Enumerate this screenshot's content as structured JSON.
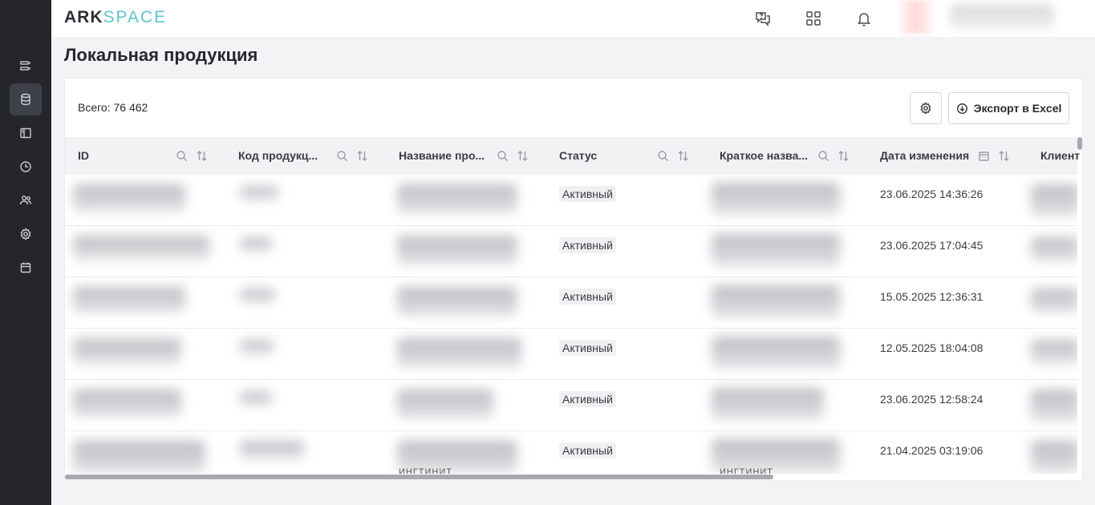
{
  "app": {
    "logo_ark": "ARK",
    "logo_space": "SPACE"
  },
  "sidebar": {
    "items": [
      {
        "icon": "list-icon",
        "active": false
      },
      {
        "icon": "database-icon",
        "active": true
      },
      {
        "icon": "panel-icon",
        "active": false
      },
      {
        "icon": "clock-icon",
        "active": false
      },
      {
        "icon": "users-icon",
        "active": false
      },
      {
        "icon": "gear-icon",
        "active": false
      },
      {
        "icon": "calendar-icon",
        "active": false
      }
    ]
  },
  "topbar": {
    "icons": [
      "support-chat-icon",
      "apps-grid-icon",
      "bell-icon"
    ]
  },
  "page": {
    "title": "Локальная продукция"
  },
  "toolbar": {
    "total": "Всего: 76 462",
    "export_label": "Экспорт в Excel"
  },
  "table": {
    "columns": [
      {
        "label": "ID",
        "filter": "search"
      },
      {
        "label": "Код продукц...",
        "filter": "search"
      },
      {
        "label": "Название про...",
        "filter": "search"
      },
      {
        "label": "Статус",
        "filter": "search"
      },
      {
        "label": "Краткое назва...",
        "filter": "search"
      },
      {
        "label": "Дата изменения",
        "filter": "calendar"
      },
      {
        "label": "Клиент",
        "filter": ""
      }
    ],
    "rows": [
      {
        "status": "Активный",
        "date": "23.06.2025 14:36:26"
      },
      {
        "status": "Активный",
        "date": "23.06.2025 17:04:45"
      },
      {
        "status": "Активный",
        "date": "15.05.2025 12:36:31"
      },
      {
        "status": "Активный",
        "date": "12.05.2025 18:04:08"
      },
      {
        "status": "Активный",
        "date": "23.06.2025 12:58:24"
      },
      {
        "status": "Активный",
        "date": "21.04.2025 03:19:06"
      }
    ],
    "clipped_text": "ИНГТИНИТ"
  },
  "colors": {
    "sidebar": "#24262b",
    "accent": "#5fc3cf",
    "background": "#f3f3f6"
  }
}
